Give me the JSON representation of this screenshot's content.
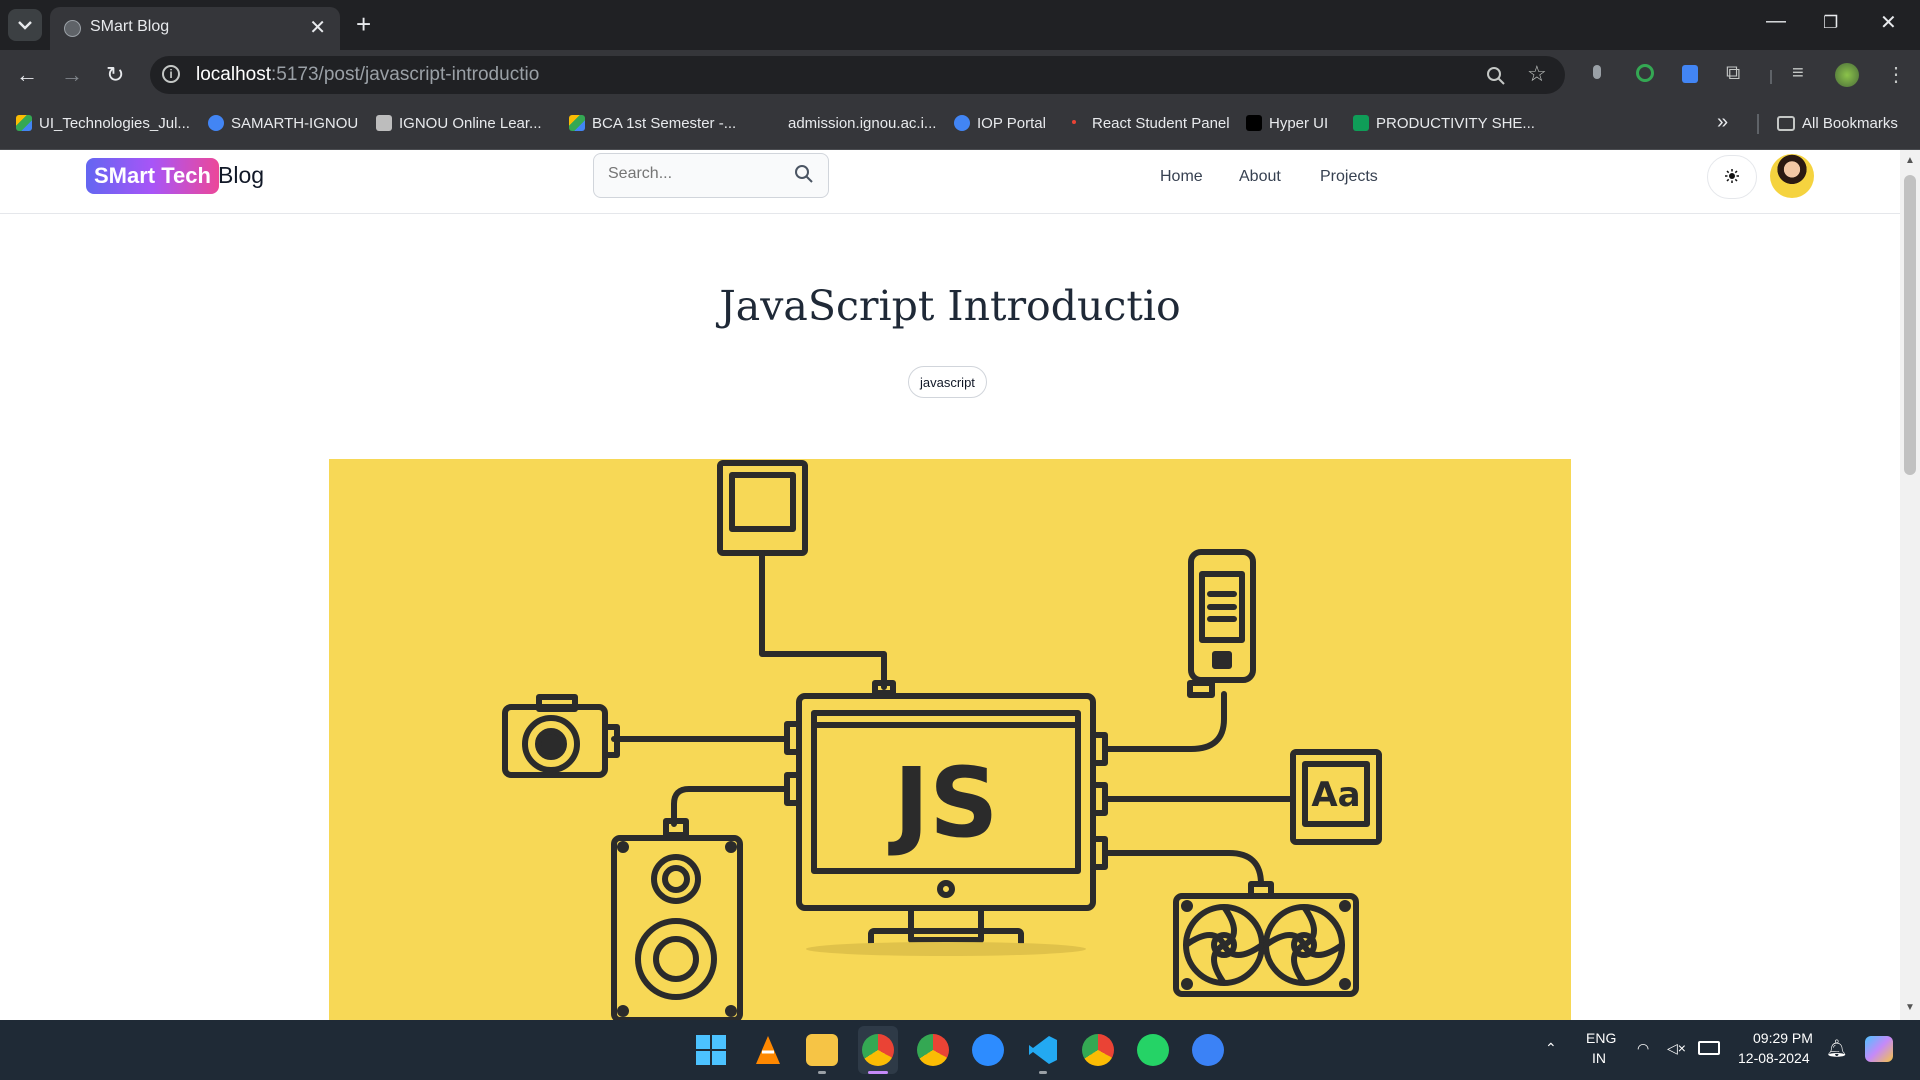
{
  "browser": {
    "tab_title": "SMart Blog",
    "url_host": "localhost",
    "url_path": ":5173/post/javascript-introductio",
    "bookmarks": [
      {
        "label": "UI_Technologies_Jul...",
        "color": "#34a853"
      },
      {
        "label": "SAMARTH-IGNOU",
        "color": "#4285f4"
      },
      {
        "label": "IGNOU Online Lear...",
        "color": "#9e9e9e"
      },
      {
        "label": "BCA 1st Semester -...",
        "color": "#fbbc04"
      },
      {
        "label": "admission.ignou.ac.i...",
        "color": ""
      },
      {
        "label": "IOP Portal",
        "color": "#4285f4"
      },
      {
        "label": "React Student Panel",
        "color": "#ea4335"
      },
      {
        "label": "Hyper UI",
        "color": "#000000"
      },
      {
        "label": "PRODUCTIVITY SHE...",
        "color": "#0f9d58"
      }
    ],
    "overflow_label": "»",
    "all_bookmarks_label": "All Bookmarks"
  },
  "app": {
    "logo_badge": "SMart Tech",
    "logo_text": "Blog",
    "search_placeholder": "Search...",
    "nav": [
      "Home",
      "About",
      "Projects"
    ],
    "theme_toggle_icon": "sun-icon"
  },
  "post": {
    "title": "JavaScript Introductio",
    "tag": "javascript",
    "hero_text": "JS",
    "hero_icon_text": "Aa",
    "hero_bg": "#f7d856"
  },
  "taskbar": {
    "lang_top": "ENG",
    "lang_bottom": "IN",
    "time": "09:29 PM",
    "date": "12-08-2024"
  }
}
